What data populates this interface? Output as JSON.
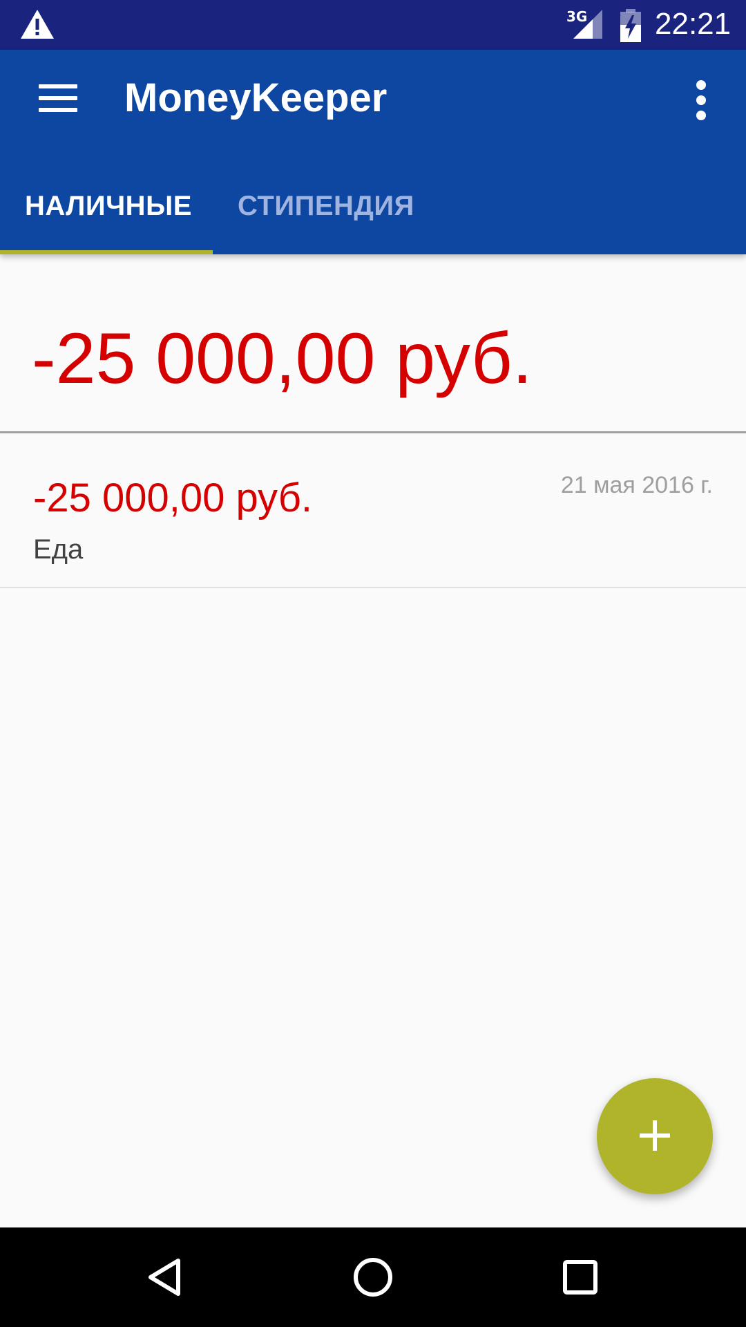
{
  "status_bar": {
    "network_label": "3G",
    "time": "22:21",
    "icons": [
      "warning-icon",
      "signal-icon",
      "battery-charging-icon"
    ]
  },
  "app_bar": {
    "title": "MoneyKeeper",
    "menu_icon": "hamburger-icon",
    "overflow_icon": "more-vert-icon",
    "tabs": [
      {
        "label": "НАЛИЧНЫЕ",
        "selected": true
      },
      {
        "label": "СТИПЕНДИЯ",
        "selected": false
      }
    ]
  },
  "summary": {
    "total": "-25 000,00 руб."
  },
  "transactions": [
    {
      "amount": "-25 000,00 руб.",
      "date": "21 мая 2016 г.",
      "category": "Еда"
    }
  ],
  "fab": {
    "icon": "plus-icon"
  },
  "nav_bar": {
    "icons": [
      "back-icon",
      "home-icon",
      "recents-icon"
    ]
  },
  "colors": {
    "status_bar": "#1a237e",
    "app_bar": "#0d47a1",
    "accent": "#afb42b",
    "negative_amount": "#d50000",
    "background": "#fafafa"
  }
}
